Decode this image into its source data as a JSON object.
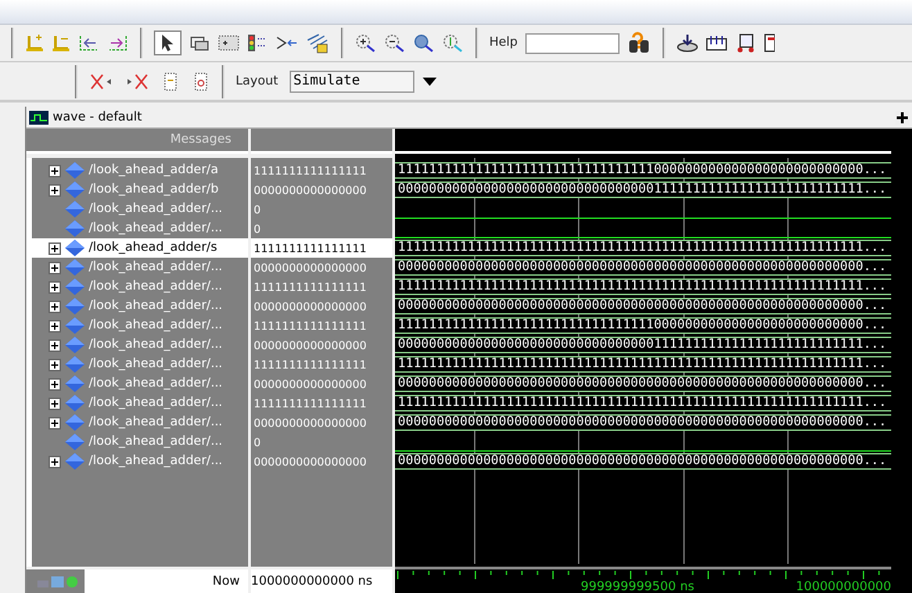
{
  "toolbar": {
    "help_label": "Help",
    "layout_label": "Layout",
    "layout_value": "Simulate"
  },
  "wave_window": {
    "title": "wave - default",
    "messages_header": "Messages",
    "signals": [
      {
        "name": "/look_ahead_adder/a",
        "value": "1111111111111111",
        "kind": "bus",
        "selected": false,
        "wave": "111111111111111111111111111111111000000000000000000000000000..."
      },
      {
        "name": "/look_ahead_adder/b",
        "value": "0000000000000000",
        "kind": "bus",
        "selected": false,
        "wave": "000000000000000000000000000000000111111111111111111111111111..."
      },
      {
        "name": "/look_ahead_adder/...",
        "value": "0",
        "kind": "bit",
        "high": false,
        "selected": false
      },
      {
        "name": "/look_ahead_adder/...",
        "value": "0",
        "kind": "bit",
        "high": false,
        "selected": false
      },
      {
        "name": "/look_ahead_adder/s",
        "value": "1111111111111111",
        "kind": "bus",
        "selected": true,
        "wave": "111111111111111111111111111111111111111111111111111111111111..."
      },
      {
        "name": "/look_ahead_adder/...",
        "value": "0000000000000000",
        "kind": "bus",
        "selected": false,
        "wave": "000000000000000000000000000000000000000000000000000000000000..."
      },
      {
        "name": "/look_ahead_adder/...",
        "value": "1111111111111111",
        "kind": "bus",
        "selected": false,
        "wave": "111111111111111111111111111111111111111111111111111111111111..."
      },
      {
        "name": "/look_ahead_adder/...",
        "value": "0000000000000000",
        "kind": "bus",
        "selected": false,
        "wave": "000000000000000000000000000000000000000000000000000000000000..."
      },
      {
        "name": "/look_ahead_adder/...",
        "value": "1111111111111111",
        "kind": "bus",
        "selected": false,
        "wave": "111111111111111111111111111111111000000000000000000000000000..."
      },
      {
        "name": "/look_ahead_adder/...",
        "value": "0000000000000000",
        "kind": "bus",
        "selected": false,
        "wave": "000000000000000000000000000000000111111111111111111111111111..."
      },
      {
        "name": "/look_ahead_adder/...",
        "value": "1111111111111111",
        "kind": "bus",
        "selected": false,
        "wave": "111111111111111111111111111111111111111111111111111111111111..."
      },
      {
        "name": "/look_ahead_adder/...",
        "value": "0000000000000000",
        "kind": "bus",
        "selected": false,
        "wave": "000000000000000000000000000000000000000000000000000000000000..."
      },
      {
        "name": "/look_ahead_adder/...",
        "value": "1111111111111111",
        "kind": "bus",
        "selected": false,
        "wave": "111111111111111111111111111111111111111111111111111111111111..."
      },
      {
        "name": "/look_ahead_adder/...",
        "value": "0000000000000000",
        "kind": "bus",
        "selected": false,
        "wave": "000000000000000000000000000000000000000000000000000000000000..."
      },
      {
        "name": "/look_ahead_adder/...",
        "value": "0",
        "kind": "bit",
        "high": false,
        "selected": false
      },
      {
        "name": "/look_ahead_adder/...",
        "value": "0000000000000000",
        "kind": "bus",
        "selected": false,
        "wave": "000000000000000000000000000000000000000000000000000000000000..."
      }
    ],
    "now_label": "Now",
    "now_value": "1000000000000 ns",
    "timeline_labels": [
      "999999999500 ns",
      "100000000000"
    ]
  }
}
